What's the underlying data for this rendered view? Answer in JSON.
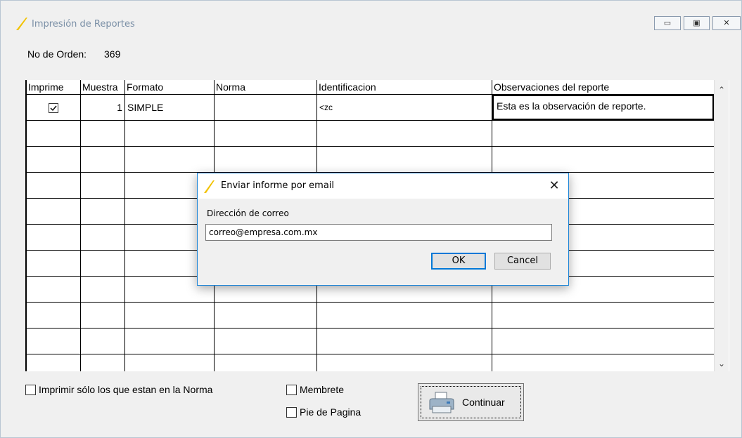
{
  "window": {
    "title": "Impresión de Reportes"
  },
  "order": {
    "label": "No de Orden:",
    "value": "369"
  },
  "grid": {
    "columns": [
      "Imprime",
      "Muestra",
      "Formato",
      "Norma",
      "Identificacion",
      "Observaciones del reporte"
    ],
    "rows": [
      {
        "imprime": true,
        "muestra": "1",
        "formato": "SIMPLE",
        "norma": "",
        "identificacion": "<zc",
        "observaciones": "Esta es la observación de reporte."
      }
    ]
  },
  "options": {
    "solo_norma": "Imprimir sólo los que estan en la Norma",
    "membrete": "Membrete",
    "pie_pagina": "Pie de Pagina"
  },
  "buttons": {
    "continuar": "Continuar"
  },
  "dialog": {
    "title": "Enviar informe por email",
    "field_label": "Dirección de correo",
    "field_value": "correo@empresa.com.mx",
    "ok": "OK",
    "cancel": "Cancel"
  },
  "colors": {
    "accent": "#1883d7",
    "app_icon": "#f2c200"
  },
  "icons": [
    "app-logo-icon",
    "minimize-icon",
    "restore-icon",
    "close-icon",
    "checkbox-icon",
    "printer-icon",
    "scroll-up-icon",
    "scroll-down-icon"
  ]
}
